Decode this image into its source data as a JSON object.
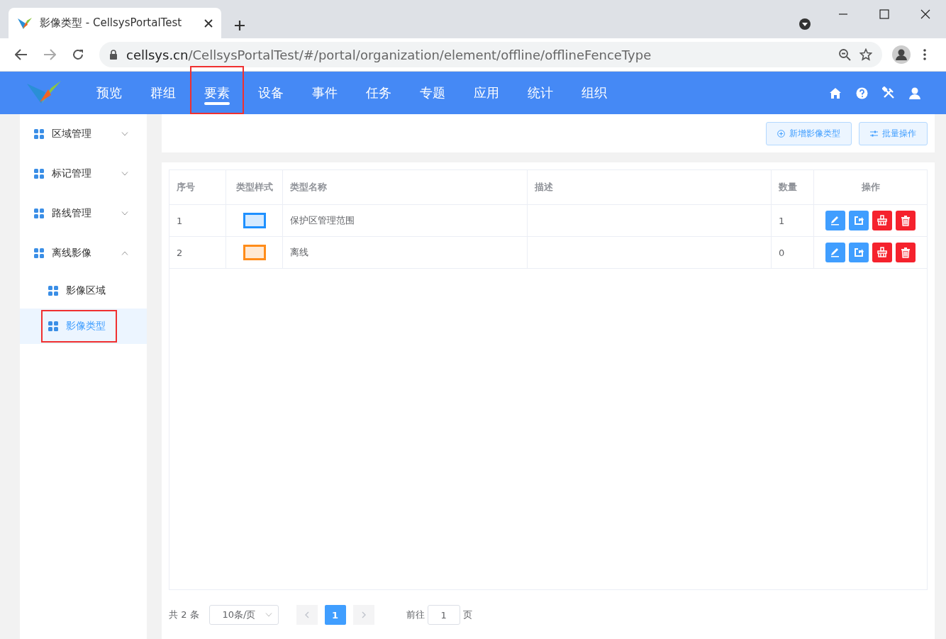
{
  "browser": {
    "tab_title": "影像类型 - CellsysPortalTest",
    "url_host": "cellsys.cn",
    "url_path": "/CellsysPortalTest/#/portal/organization/element/offline/offlineFenceType"
  },
  "nav": {
    "items": [
      {
        "label": "预览",
        "selected": false,
        "highlighted": false
      },
      {
        "label": "群组",
        "selected": false,
        "highlighted": false
      },
      {
        "label": "要素",
        "selected": true,
        "highlighted": true
      },
      {
        "label": "设备",
        "selected": false,
        "highlighted": false
      },
      {
        "label": "事件",
        "selected": false,
        "highlighted": false
      },
      {
        "label": "任务",
        "selected": false,
        "highlighted": false
      },
      {
        "label": "专题",
        "selected": false,
        "highlighted": false
      },
      {
        "label": "应用",
        "selected": false,
        "highlighted": false
      },
      {
        "label": "统计",
        "selected": false,
        "highlighted": false
      },
      {
        "label": "组织",
        "selected": false,
        "highlighted": false
      }
    ]
  },
  "sidebar": {
    "items": [
      {
        "label": "区域管理",
        "expanded": false
      },
      {
        "label": "标记管理",
        "expanded": false
      },
      {
        "label": "路线管理",
        "expanded": false
      },
      {
        "label": "离线影像",
        "expanded": true,
        "children": [
          {
            "label": "影像区域",
            "selected": false,
            "highlighted": false
          },
          {
            "label": "影像类型",
            "selected": true,
            "highlighted": true
          }
        ]
      }
    ]
  },
  "toolbar": {
    "buttons": [
      {
        "label": "新增影像类型",
        "kind": "add"
      },
      {
        "label": "批量操作",
        "kind": "batch"
      }
    ]
  },
  "table": {
    "columns": [
      "序号",
      "类型样式",
      "类型名称",
      "描述",
      "数量",
      "操作"
    ],
    "rows": [
      {
        "index": "1",
        "color": "#1e90ff",
        "name": "保护区管理范围",
        "count": "1"
      },
      {
        "index": "2",
        "color": "#ff8c1a",
        "name": "离线",
        "count": "0"
      }
    ]
  },
  "pagination": {
    "total": "共 2 条",
    "page_size": "10条/页",
    "pages": [
      {
        "label": "1",
        "selected": true
      }
    ],
    "goto_label": "前往",
    "goto_value": "1",
    "page_suffix": "页"
  }
}
